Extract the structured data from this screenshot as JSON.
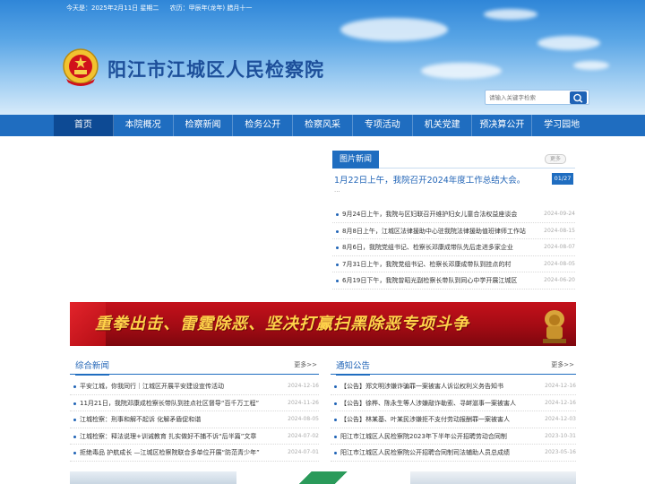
{
  "header": {
    "today_label": "今天是：2025年2月11日 星期二",
    "lunar_label": "农历：甲辰年(龙年) 腊月十一",
    "site_title": "阳江市江城区人民检察院"
  },
  "search": {
    "placeholder": "请输入关键字检索"
  },
  "nav": {
    "items": [
      "首页",
      "本院概况",
      "检察新闻",
      "检务公开",
      "检察风采",
      "专项活动",
      "机关党建",
      "预决算公开",
      "学习园地"
    ]
  },
  "photo_news": {
    "title": "图片新闻",
    "more": "更多",
    "lead": "1月22日上午，我院召开2024年度工作总结大会。",
    "page": "01/27",
    "dots": "...",
    "items": [
      {
        "title": "9月24日上午，我院与区妇联召开维护妇女儿童合法权益座谈会",
        "date": "2024-09-24"
      },
      {
        "title": "8月8日上午，江城区法律援助中心驻我院法律援助值班律师工作站",
        "date": "2024-08-15"
      },
      {
        "title": "8月6日，我院党组书记、检察长邓康成带队先后走进多家企业",
        "date": "2024-08-07"
      },
      {
        "title": "7月31日上午，我院党组书记、检察长邓康成带队到挂点的村",
        "date": "2024-08-05"
      },
      {
        "title": "6月19日下午，我院曾昭光副检察长带队到同心中学开展江城区",
        "date": "2024-06-20"
      }
    ]
  },
  "banner": {
    "text": "重拳出击、雷霆除恶、坚决打赢扫黑除恶专项斗争"
  },
  "general_news": {
    "title": "综合新闻",
    "more": "更多>>",
    "items": [
      {
        "title": "平安江城，你我同行｜江城区开展平安建设宣传活动",
        "date": "2024-12-16"
      },
      {
        "title": "11月21日，我院邓康成检察长带队到挂点社区督导“百千万工程”",
        "date": "2024-11-26"
      },
      {
        "title": "江城检察：刑事和解不起诉 化解矛盾促和谐",
        "date": "2024-08-05"
      },
      {
        "title": "江城检察：释法说理+训诫教育 扎实做好不捕不诉“后半篇”文章",
        "date": "2024-07-02"
      },
      {
        "title": "拒绝毒品 护航成长 —江城区检察院联合多单位开展“防范青少年”",
        "date": "2024-07-01"
      }
    ]
  },
  "notices": {
    "title": "通知公告",
    "more": "更多>>",
    "items": [
      {
        "title": "【公告】郑文明涉嫌诈骗罪一案被害人诉讼权利义务告知书",
        "date": "2024-12-16"
      },
      {
        "title": "【公告】徐桦、陈永生等人涉嫌敲诈勒索、寻衅滋事一案被害人",
        "date": "2024-12-16"
      },
      {
        "title": "【公告】林某基、叶某民涉嫌拒不支付劳动报酬罪一案被害人",
        "date": "2024-12-03"
      },
      {
        "title": "阳江市江城区人民检察院2023年下半年公开招聘劳动合同制",
        "date": "2023-10-31"
      },
      {
        "title": "阳江市江城区人民检察院公开招聘合同制司法辅助人员总成绩",
        "date": "2023-05-16"
      }
    ]
  },
  "colors": {
    "nav_bg": "#1f6dc0",
    "nav_active": "#0d4a94",
    "title_blue": "#1d4f9a",
    "banner_red": "#c4111b",
    "banner_gold": "#ffd34a"
  }
}
